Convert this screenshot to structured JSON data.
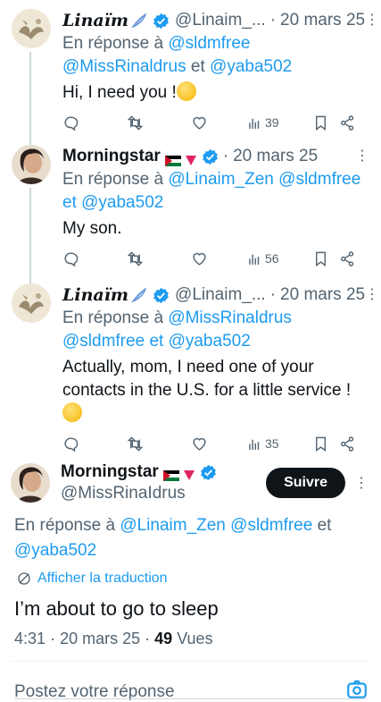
{
  "tweets": [
    {
      "name": "Linaïm",
      "handle": "@Linaim_...",
      "dot": "·",
      "date": "20 mars 25",
      "reply_prefix": "En réponse à",
      "reply_line1": "@sldmfree",
      "reply_line2a": "@MissRinaldrus",
      "reply_and": "et",
      "reply_line2b": "@yaba502",
      "text": "Hi, I need you !",
      "views": "39"
    },
    {
      "name": "Morningstar",
      "date": "20 mars 25",
      "dot": "·",
      "reply_prefix": "En réponse à",
      "reply_line1a": "@Linaim_Zen",
      "reply_line1b": "@sldmfree",
      "reply_and": "et",
      "reply_line2": "@yaba502",
      "text": "My son.",
      "views": "56"
    },
    {
      "name": "Linaïm",
      "handle": "@Linaim_...",
      "dot": "·",
      "date": "20 mars 25",
      "reply_prefix": "En réponse à",
      "reply_line1": "@MissRinaldrus",
      "reply_line2a": "@sldmfree",
      "reply_and": "et",
      "reply_line2b": "@yaba502",
      "text_line1": "Actually, mom, I need one of your",
      "text_line2": "contacts in the U.S. for a little service !",
      "views": "35"
    }
  ],
  "main": {
    "name": "Morningstar",
    "handle": "@MissRinaIdrus",
    "follow_label": "Suivre",
    "reply_prefix": "En réponse à",
    "reply_a": "@Linaim_Zen",
    "reply_b": "@sldmfree",
    "reply_and": "et",
    "reply_c": "@yaba502",
    "translate_label": "Afficher la traduction",
    "text": "I’m about to go to sleep",
    "time": "4:31",
    "sep": "·",
    "date": "20 mars 25",
    "views_count": "49",
    "views_label": "Vues"
  },
  "composer": {
    "placeholder": "Postez votre réponse"
  },
  "colors": {
    "accent": "#1d9bf0",
    "text": "#0f1419",
    "muted": "#536471"
  }
}
